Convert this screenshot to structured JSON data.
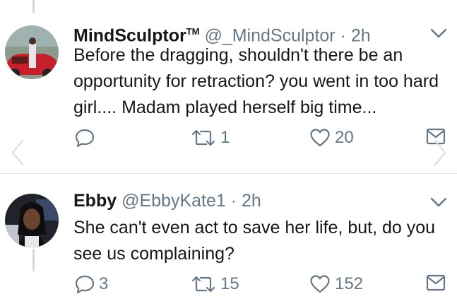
{
  "tweets": [
    {
      "display_name": "MindSculptor",
      "tm": "TM",
      "handle": "@_MindSculptor",
      "dot": "·",
      "time": "2h",
      "text": "Before the dragging, shouldn't there be an opportunity for retraction? you went in too hard girl.... Madam played herself big time...",
      "replies": "",
      "retweets": "1",
      "likes": "20"
    },
    {
      "display_name": "Ebby",
      "handle": "@EbbyKate1",
      "dot": "·",
      "time": "2h",
      "text": "She can't even act to save her life, but, do you see us complaining?",
      "replies": "3",
      "retweets": "15",
      "likes": "152"
    }
  ],
  "icons": {
    "reply": "reply-icon",
    "retweet": "retweet-icon",
    "like": "heart-icon",
    "dm": "envelope-icon",
    "more": "chevron-down-icon",
    "prev": "chevron-left-icon",
    "next": "chevron-right-icon"
  },
  "colors": {
    "text": "#14171a",
    "secondary": "#657786",
    "divider": "#e1e8ed",
    "thread_line": "#cfd9de"
  }
}
